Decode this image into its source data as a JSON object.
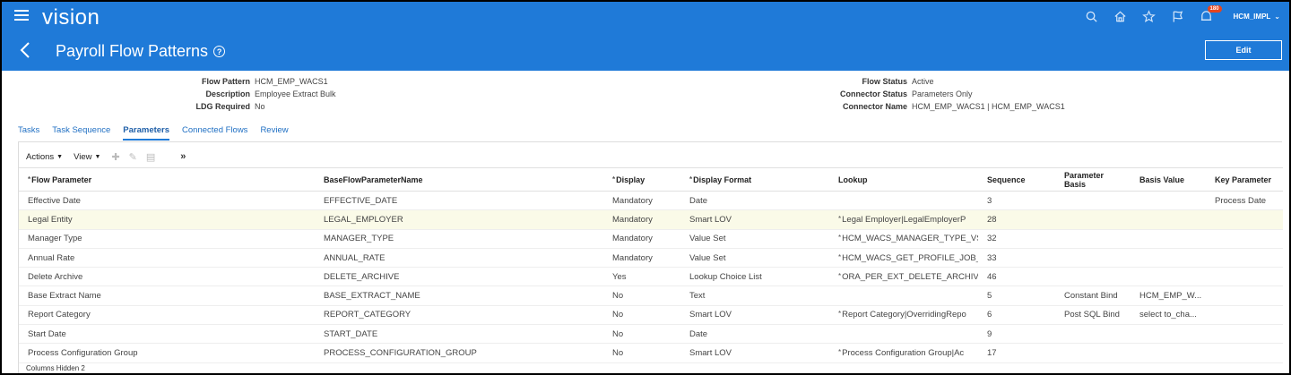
{
  "header": {
    "brand": "vision",
    "notification_count": "180",
    "user": "HCM_IMPL"
  },
  "page": {
    "title": "Payroll Flow Patterns",
    "edit_label": "Edit"
  },
  "info_left": [
    {
      "label": "Flow Pattern",
      "value": "HCM_EMP_WACS1"
    },
    {
      "label": "Description",
      "value": "Employee Extract Bulk"
    },
    {
      "label": "LDG Required",
      "value": "No"
    }
  ],
  "info_right": [
    {
      "label": "Flow Status",
      "value": "Active"
    },
    {
      "label": "Connector Status",
      "value": "Parameters Only"
    },
    {
      "label": "Connector Name",
      "value": "HCM_EMP_WACS1 | HCM_EMP_WACS1"
    }
  ],
  "tabs": [
    "Tasks",
    "Task Sequence",
    "Parameters",
    "Connected Flows",
    "Review"
  ],
  "toolbar": {
    "actions_label": "Actions",
    "view_label": "View"
  },
  "table": {
    "columns": [
      "Flow Parameter",
      "BaseFlowParameterName",
      "Display",
      "Display Format",
      "Lookup",
      "Sequence",
      "Parameter Basis",
      "Basis Value",
      "Key Parameter"
    ],
    "rows": [
      [
        "Effective Date",
        "EFFECTIVE_DATE",
        "Mandatory",
        "Date",
        "",
        "3",
        "",
        "",
        "Process Date"
      ],
      [
        "Legal Entity",
        "LEGAL_EMPLOYER",
        "Mandatory",
        "Smart LOV",
        "Legal Employer|LegalEmployerP",
        "28",
        "",
        "",
        ""
      ],
      [
        "Manager Type",
        "MANAGER_TYPE",
        "Mandatory",
        "Value Set",
        "HCM_WACS_MANAGER_TYPE_VS",
        "32",
        "",
        "",
        ""
      ],
      [
        "Annual Rate",
        "ANNUAL_RATE",
        "Mandatory",
        "Value Set",
        "HCM_WACS_GET_PROFILE_JOB_A",
        "33",
        "",
        "",
        ""
      ],
      [
        "Delete Archive",
        "DELETE_ARCHIVE",
        "Yes",
        "Lookup Choice List",
        "ORA_PER_EXT_DELETE_ARCHIVE",
        "46",
        "",
        "",
        ""
      ],
      [
        "Base Extract Name",
        "BASE_EXTRACT_NAME",
        "No",
        "Text",
        "",
        "5",
        "Constant Bind",
        "HCM_EMP_W...",
        ""
      ],
      [
        "Report Category",
        "REPORT_CATEGORY",
        "No",
        "Smart LOV",
        "Report Category|OverridingRepo",
        "6",
        "Post SQL Bind",
        "select to_cha...",
        ""
      ],
      [
        "Start Date",
        "START_DATE",
        "No",
        "Date",
        "",
        "9",
        "",
        "",
        ""
      ],
      [
        "Process Configuration Group",
        "PROCESS_CONFIGURATION_GROUP",
        "No",
        "Smart LOV",
        "Process Configuration Group|Ac",
        "17",
        "",
        "",
        ""
      ]
    ]
  },
  "footer": {
    "columns_hidden": "Columns Hidden 2"
  }
}
